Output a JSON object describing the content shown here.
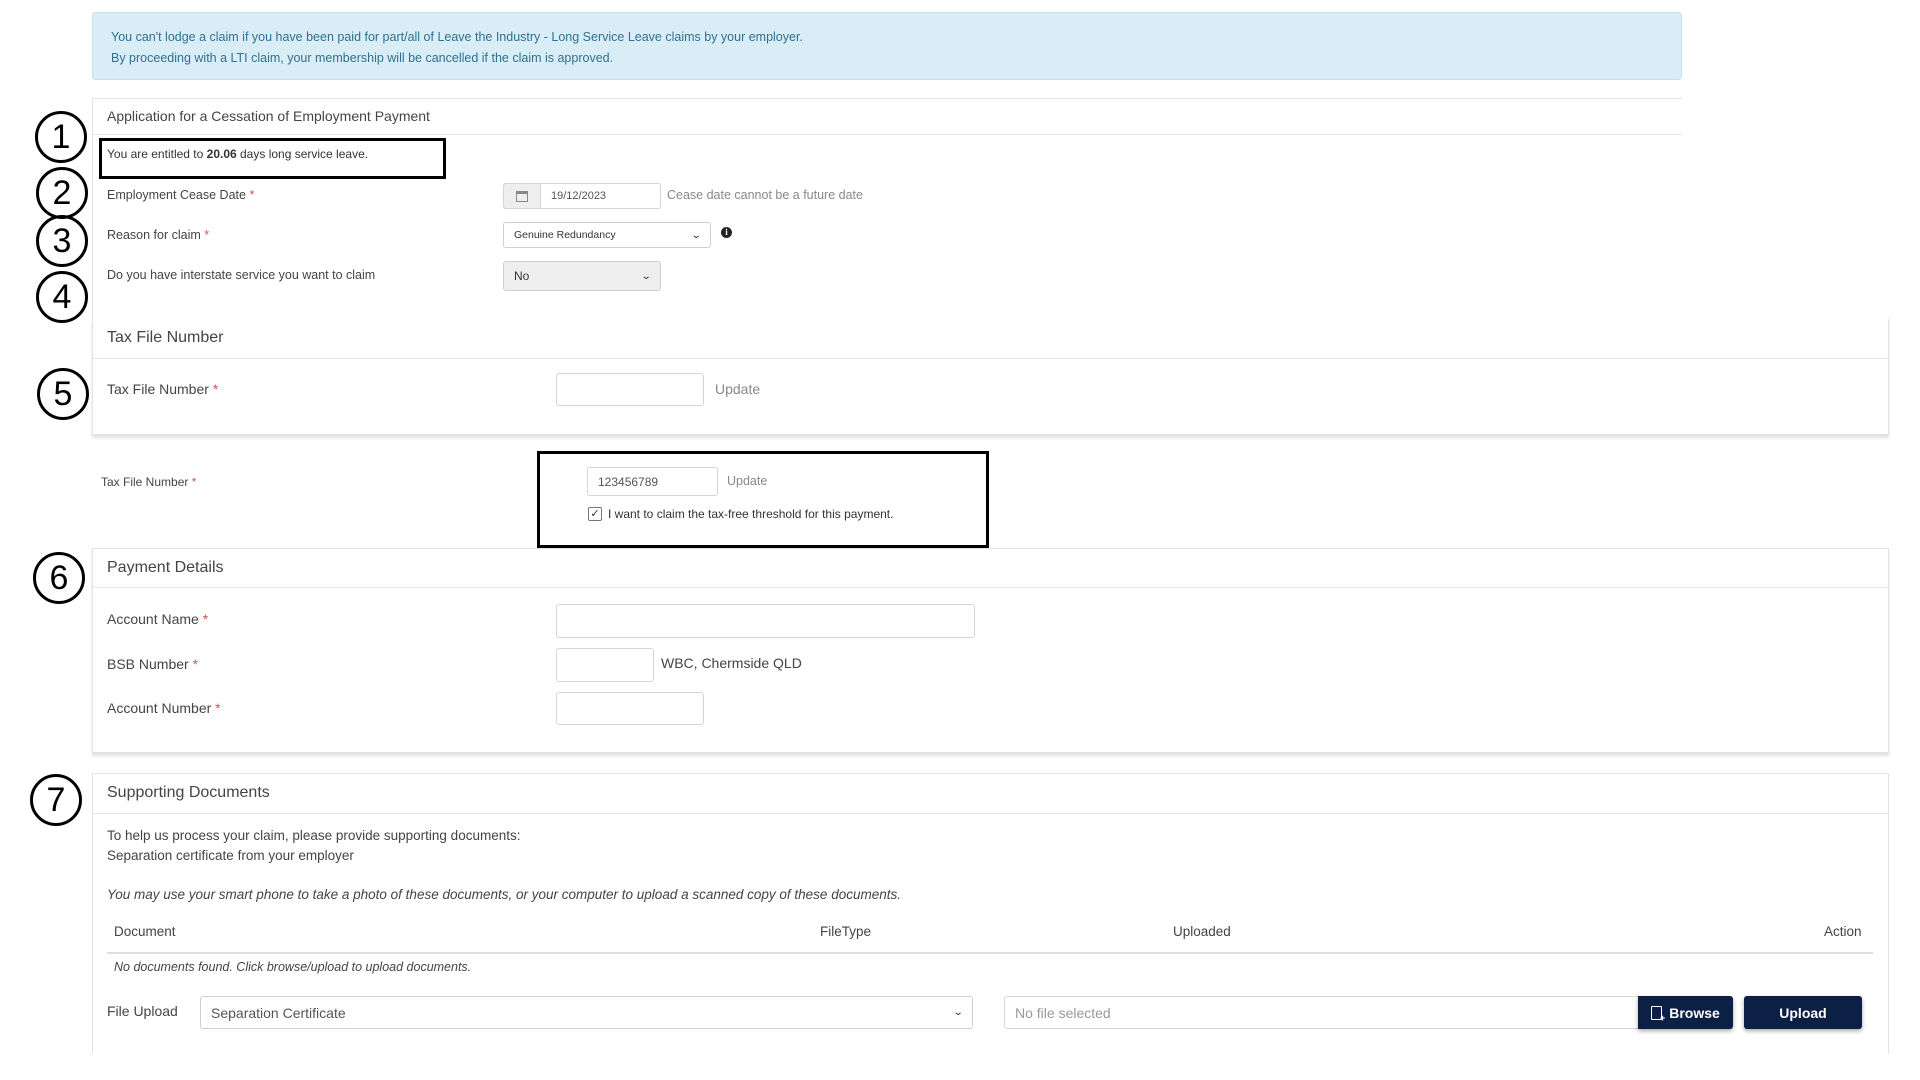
{
  "notice": {
    "line1": "You can't lodge a claim if you have been paid for part/all of Leave the Industry - Long Service Leave claims by your employer.",
    "line2": "By proceeding with a LTI claim, your membership will be cancelled if the claim is approved.",
    "colors": {
      "background": "#d9edf7",
      "text": "#31708f"
    }
  },
  "application": {
    "title": "Application for a Cessation of Employment Payment",
    "entitlement": {
      "prefix": "You are entitled to ",
      "days": "20.06",
      "suffix": " days long service leave."
    },
    "cease_date": {
      "label": "Employment Cease Date",
      "required": "*",
      "value": "19/12/2023",
      "icon": "calendar-icon",
      "note": "Cease date cannot be a future date"
    },
    "reason": {
      "label": "Reason for claim",
      "required": "*",
      "selected": "Genuine Redundancy",
      "icon": "info-icon"
    },
    "interstate": {
      "label": "Do you have interstate service you want to claim",
      "selected": "No"
    }
  },
  "tax_file": {
    "title": "Tax File Number",
    "label": "Tax File Number",
    "required": "*",
    "value": "",
    "update_label": "Update"
  },
  "tax_file_example": {
    "label": "Tax File Number",
    "required": "*",
    "value": "123456789",
    "update_label": "Update",
    "checkbox_label": "I want to claim the tax-free threshold for this payment.",
    "checkbox_checked": true
  },
  "payment": {
    "title": "Payment Details",
    "account_name": {
      "label": "Account Name",
      "required": "*",
      "value": ""
    },
    "bsb": {
      "label": "BSB Number",
      "required": "*",
      "value": "",
      "bank_info": "WBC, Chermside QLD"
    },
    "account_number": {
      "label": "Account Number",
      "required": "*",
      "value": ""
    }
  },
  "documents": {
    "title": "Supporting Documents",
    "intro_line1": "To help us process your claim, please provide supporting documents:",
    "intro_line2": "Separation certificate from your employer",
    "hint": "You may use your smart phone to take a photo of these documents, or your computer to upload a scanned copy of these documents.",
    "table": {
      "columns": [
        "Document",
        "FileType",
        "Uploaded",
        "Action"
      ],
      "empty_message": "No documents found. Click browse/upload to upload documents."
    },
    "upload": {
      "label": "File Upload",
      "doc_type_selected": "Separation Certificate",
      "file_placeholder": "No file selected",
      "browse_label": "Browse",
      "upload_label": "Upload",
      "button_color": "#0c1f45"
    }
  },
  "annotations": [
    "1",
    "2",
    "3",
    "4",
    "5",
    "6",
    "7"
  ]
}
